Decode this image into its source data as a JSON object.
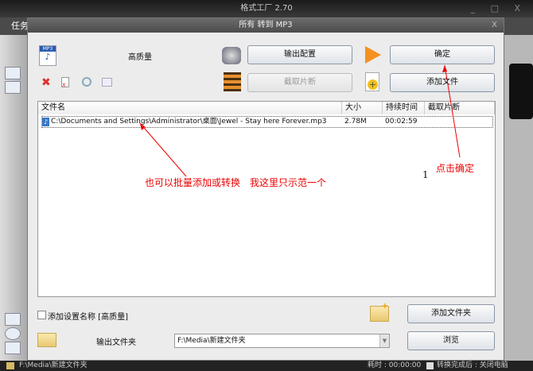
{
  "app_title": "格式工厂 2.70",
  "outer_menu_label": "任务",
  "dialog": {
    "title": "所有 转到 MP3",
    "quality_label": "高质量",
    "output_config_button": "输出配置",
    "ok_button": "确定",
    "clip_button": "截取片断",
    "add_file_button": "添加文件",
    "columns": [
      "文件名",
      "大小",
      "持续时间",
      "截取片断"
    ],
    "files": [
      {
        "name": "C:\\Documents and Settings\\Administrator\\桌面\\Jewel - Stay here Forever.mp3",
        "size": "2.78M",
        "duration": "00:02:59",
        "clip": ""
      }
    ],
    "add_setting_name_label": "添加设置名称 [高质量]",
    "add_folder_button": "添加文件夹",
    "output_folder_label": "输出文件夹",
    "output_folder_value": "F:\\Media\\新建文件夹",
    "browse_button": "浏览"
  },
  "annotations": {
    "batch_note": "也可以批量添加或转换　我这里只示范一个",
    "click_ok_note": "点击确定",
    "number": "1"
  },
  "status": {
    "path": "F:\\Media\\新建文件夹",
    "elapsed": "耗时 : 00:00:00",
    "after_convert": "转换完成后 : 关闭电脑"
  },
  "colors": {
    "annotation": "#ee0000"
  }
}
